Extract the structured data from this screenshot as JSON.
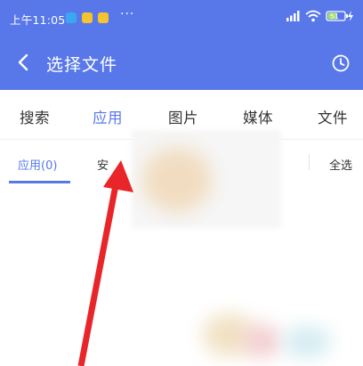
{
  "status_bar": {
    "time": "上午11:05",
    "dots": "···",
    "battery_level": "51"
  },
  "app_bar": {
    "title": "选择文件"
  },
  "category_tabs": [
    {
      "label": "搜索",
      "active": false
    },
    {
      "label": "应用",
      "active": true
    },
    {
      "label": "图片",
      "active": false
    },
    {
      "label": "媒体",
      "active": false
    },
    {
      "label": "文件",
      "active": false
    }
  ],
  "sub_tabs": {
    "apps": "应用(0)",
    "installed_partial": "安",
    "select_all": "全选"
  },
  "colors": {
    "accent": "#5878ea",
    "arrow": "#e8262a"
  },
  "icons": [
    "back-icon",
    "history-icon",
    "wifi-icon",
    "signal-icon",
    "battery-icon",
    "charging-icon"
  ]
}
